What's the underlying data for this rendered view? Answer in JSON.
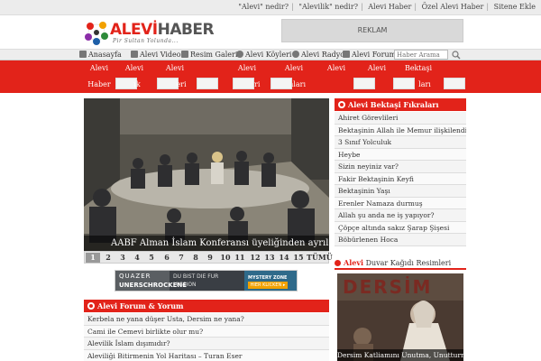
{
  "top_links": [
    "\"Alevi\" nedir?",
    "\"Alevilik\" nedir?",
    "Alevi Haber",
    "Özel Alevi Haber",
    "Sitene Ekle"
  ],
  "logo": {
    "brand_red": "ALEVİ",
    "brand_gray": "HABER",
    "tagline": "Pir Sultan Yolunda..."
  },
  "top_ad": "REKLAM",
  "subnav": {
    "items": [
      {
        "label": "Anasayfa",
        "icon": "home-icon"
      },
      {
        "label": "Alevi Video",
        "icon": "video-icon"
      },
      {
        "label": "Resim Galeri",
        "icon": "camera-icon"
      },
      {
        "label": "Alevi Köyleri",
        "icon": "globe-icon"
      },
      {
        "label": "Alevi Radyo",
        "icon": "radio-icon"
      },
      {
        "label": "Alevi Forum",
        "icon": "forum-icon"
      }
    ],
    "search_placeholder": "Haber Arama"
  },
  "menu": [
    {
      "l1": "Alevi",
      "l2": "Haber"
    },
    {
      "l1": "Alevi",
      "l2": ""
    },
    {
      "l1": "Alevi",
      "l2": ""
    },
    {
      "l1": "",
      "l2": ""
    },
    {
      "l1": "Alevi",
      "l2": "Köyleri"
    },
    {
      "l1": "Alevi",
      "l2": ""
    },
    {
      "l1": "Alevi",
      "l2": ""
    },
    {
      "l1": "Alevi",
      "l2": ""
    },
    {
      "l1": "Bektaşi",
      "l2": ""
    }
  ],
  "menu_fragments": [
    "Haber",
    "ık",
    "eri",
    "Köyleri",
    "amları",
    "ları"
  ],
  "slider": {
    "caption": "AABF Alman İslam Konferansı üyeliğinden ayrılsın!",
    "pages": [
      "1",
      "2",
      "3",
      "4",
      "5",
      "6",
      "7",
      "8",
      "9",
      "10",
      "11",
      "12",
      "13",
      "14",
      "15"
    ],
    "active_page": "1",
    "all_label": "TÜMÜ"
  },
  "banner": {
    "brand": "QUAZER",
    "headline": "UNERSCHROCKENE",
    "sub1": "DU BIST DIE FUR",
    "sub2": "MISSION",
    "badge": "MYSTERY ZONE",
    "cta": "HIER KLICKEN ▸"
  },
  "forum": {
    "title": "Alevi Forum & Yorum",
    "items": [
      "Kerbela ne yana düşer Usta, Dersim ne yana?",
      "Cami ile Cemevi birlikte olur mu?",
      "Alevilik İslam dışımıdır?",
      "Aleviliği Bitirmenin Yol Haritası – Turan Eser"
    ]
  },
  "fikralar": {
    "title": "Alevi Bektaşi Fıkraları",
    "items": [
      "Ahiret Görevlileri",
      "Bektaşinin Allah ile Memur ilişkilendirmesi",
      "3 Sınıf Yolculuk",
      "Heybe",
      "Sizin neyiniz var?",
      "Fakir Bektaşinin Keyfi",
      "Bektaşinin Yaşı",
      "Erenler Namaza durmuş",
      "Allah şu anda ne iş yapıyor?",
      "Çöpçe altında sakız Şarap Şişesi",
      "Böbürlenen Hoca"
    ]
  },
  "wallpaper": {
    "head_bold": "Alevi",
    "head_rest": "Duvar Kağıdı Resimleri",
    "image_title": "DERSİM",
    "caption": "Dersim Katliamını Unutma, Unutturma!"
  },
  "colors": {
    "accent": "#e2231a",
    "bg_bar": "#ececec"
  }
}
